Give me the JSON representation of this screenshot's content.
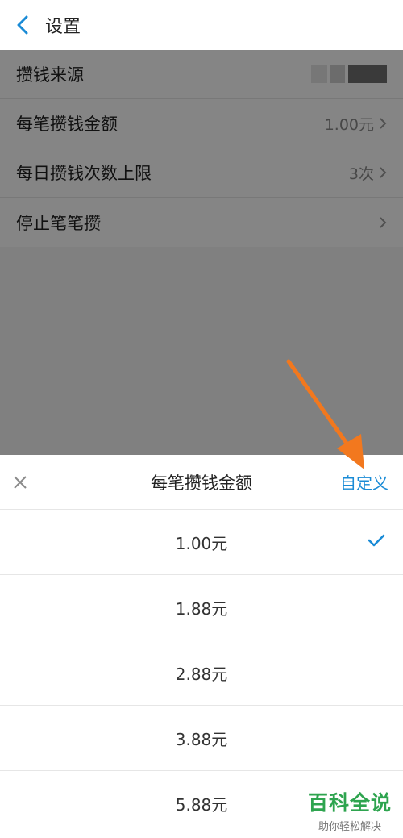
{
  "header": {
    "title": "设置",
    "back_icon": "chevron-left-icon"
  },
  "settings": {
    "rows": [
      {
        "label": "攒钱来源",
        "value": ""
      },
      {
        "label": "每笔攒钱金额",
        "value": "1.00元"
      },
      {
        "label": "每日攒钱次数上限",
        "value": "3次"
      },
      {
        "label": "停止笔笔攒",
        "value": ""
      }
    ]
  },
  "sheet": {
    "title": "每笔攒钱金额",
    "custom_label": "自定义",
    "options": [
      {
        "label": "1.00元",
        "selected": true
      },
      {
        "label": "1.88元",
        "selected": false
      },
      {
        "label": "2.88元",
        "selected": false
      },
      {
        "label": "3.88元",
        "selected": false
      },
      {
        "label": "5.88元",
        "selected": false
      }
    ]
  },
  "watermark": {
    "main": "百科全说",
    "sub": "助你轻松解决"
  },
  "colors": {
    "accent": "#1a8bd6",
    "arrow": "#f2781e",
    "watermark": "#2ea44f"
  }
}
